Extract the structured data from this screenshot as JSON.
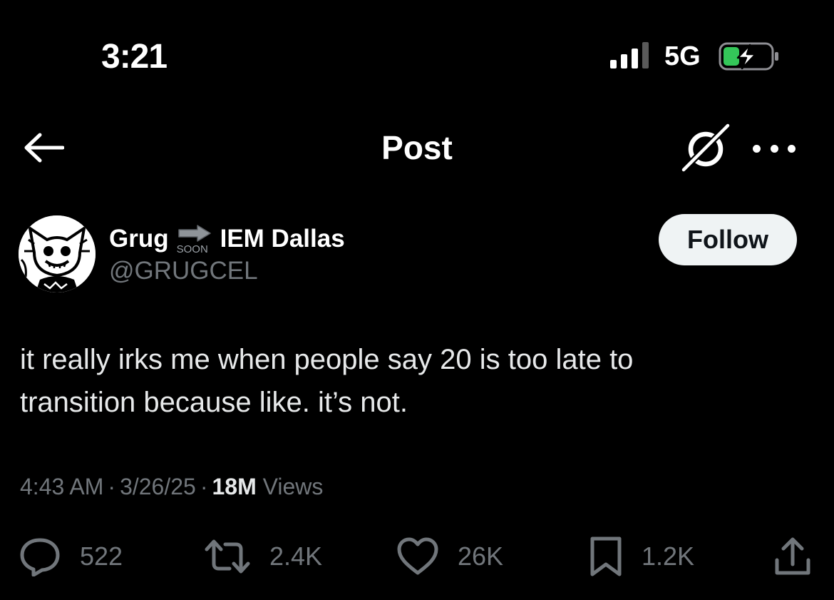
{
  "status_bar": {
    "time": "3:21",
    "network": "5G",
    "battery_charging": true,
    "battery_color": "#34c759"
  },
  "header": {
    "back_icon": "arrow-left-icon",
    "title": "Post",
    "grok_icon": "grok-icon",
    "more_icon": "more-horizontal-icon"
  },
  "author": {
    "name_part1": "Grug",
    "emoji_label": "SOON",
    "name_part2": "IEM Dallas",
    "handle": "@GRUGCEL",
    "follow_label": "Follow"
  },
  "post": {
    "text_line1": "it really irks me when people say 20 is too late to",
    "text_line2": "transition because like. it’s not.",
    "time": "4:43 AM",
    "date": "3/26/25",
    "views_count": "18M",
    "views_label": "Views",
    "separator": "·"
  },
  "actions": {
    "replies": "522",
    "reposts": "2.4K",
    "likes": "26K",
    "bookmarks": "1.2K"
  },
  "colors": {
    "background": "#000000",
    "text": "#e7e9ea",
    "muted": "#71767b",
    "follow_bg": "#eff3f4"
  }
}
